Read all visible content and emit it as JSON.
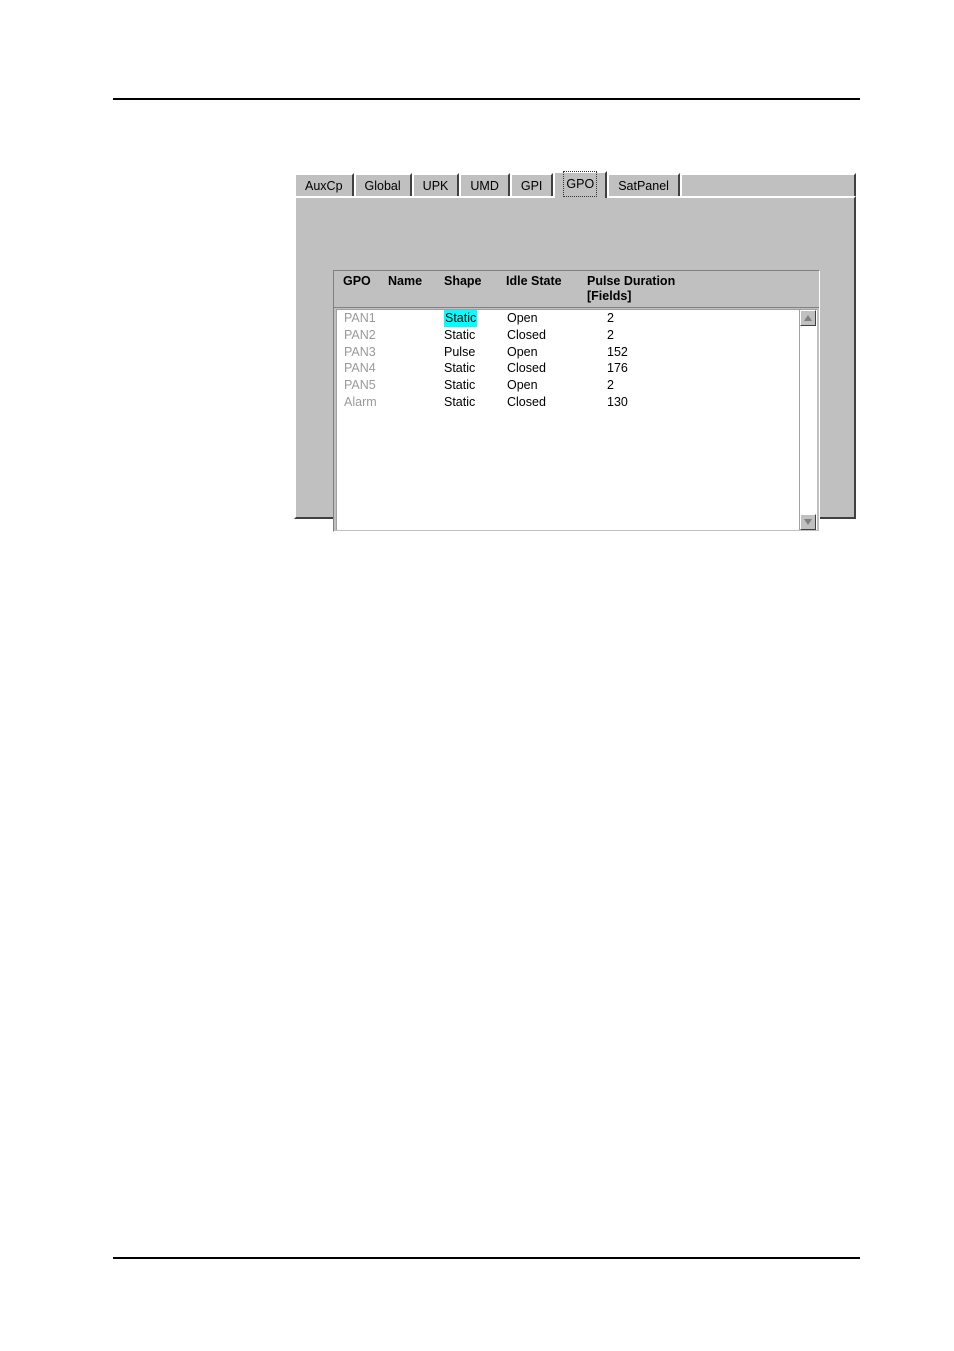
{
  "page": {
    "header_rule": "",
    "footer_rule": ""
  },
  "dialog": {
    "tabs": [
      {
        "label": "AuxCp",
        "selected": false
      },
      {
        "label": "Global",
        "selected": false
      },
      {
        "label": "UPK",
        "selected": false
      },
      {
        "label": "UMD",
        "selected": false
      },
      {
        "label": "GPI",
        "selected": false
      },
      {
        "label": "GPO",
        "selected": true
      },
      {
        "label": "SatPanel",
        "selected": false
      }
    ],
    "active_tab": "GPO",
    "grid": {
      "columns": [
        {
          "key": "gpo",
          "label": "GPO",
          "sublabel": ""
        },
        {
          "key": "name",
          "label": "Name",
          "sublabel": ""
        },
        {
          "key": "shape",
          "label": "Shape",
          "sublabel": ""
        },
        {
          "key": "idle",
          "label": "Idle State",
          "sublabel": ""
        },
        {
          "key": "pulse",
          "label": "Pulse Duration",
          "sublabel": "[Fields]"
        }
      ],
      "rows": [
        {
          "gpo": "PAN1",
          "name": "",
          "shape": "Static",
          "idle": "Open",
          "pulse": "2"
        },
        {
          "gpo": "PAN2",
          "name": "",
          "shape": "Static",
          "idle": "Closed",
          "pulse": "2"
        },
        {
          "gpo": "PAN3",
          "name": "",
          "shape": "Pulse",
          "idle": "Open",
          "pulse": "152"
        },
        {
          "gpo": "PAN4",
          "name": "",
          "shape": "Static",
          "idle": "Closed",
          "pulse": "176"
        },
        {
          "gpo": "PAN5",
          "name": "",
          "shape": "Static",
          "idle": "Open",
          "pulse": "2"
        },
        {
          "gpo": "Alarm",
          "name": "",
          "shape": "Static",
          "idle": "Closed",
          "pulse": "130"
        }
      ],
      "selected_cell": {
        "row": 0,
        "column": "shape",
        "value": "Static"
      },
      "scrollbar": {
        "up_arrow": "scroll-up-arrow",
        "down_arrow": "scroll-down-arrow",
        "thumb_visible": false
      }
    }
  },
  "colors": {
    "selection_highlight": "#00ffff",
    "dialog_face": "#c0c0c0",
    "list_background": "#ffffff",
    "readonly_text": "#9a9a9a",
    "text": "#000000"
  }
}
